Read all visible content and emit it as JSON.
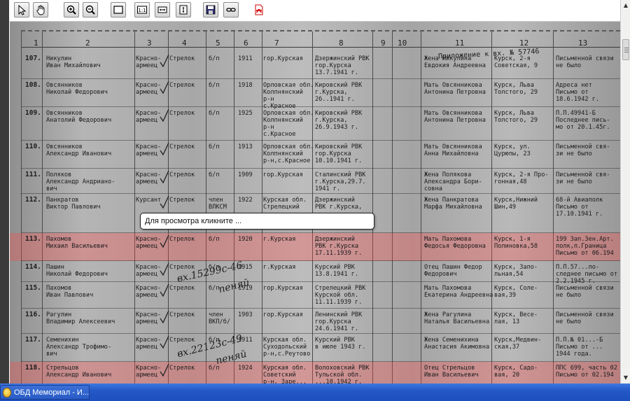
{
  "toolbar": {
    "buttons": [
      {
        "name": "pointer-tool-button",
        "icon": "arrow-pointer-icon"
      },
      {
        "name": "pan-tool-button",
        "icon": "hand-icon"
      },
      {
        "name": "zoom-in-button",
        "icon": "zoom-in-icon"
      },
      {
        "name": "zoom-out-button",
        "icon": "zoom-out-icon"
      },
      {
        "name": "fit-page-button",
        "icon": "page-frame-icon"
      },
      {
        "name": "actual-size-button",
        "icon": "one-to-one-icon",
        "label": "1:1"
      },
      {
        "name": "fit-width-button",
        "icon": "fit-width-icon"
      },
      {
        "name": "fit-height-button",
        "icon": "fit-height-icon"
      },
      {
        "name": "save-button",
        "icon": "floppy-disk-icon"
      },
      {
        "name": "link-button",
        "icon": "chain-link-icon"
      },
      {
        "name": "pdf-button",
        "icon": "pdf-icon"
      }
    ]
  },
  "document": {
    "column_numbers": [
      "1",
      "2",
      "3",
      "4",
      "5",
      "6",
      "7",
      "8",
      "9",
      "10",
      "11",
      "12",
      "13"
    ],
    "header_note": "Приложение к вх. № 57746",
    "rows": [
      {
        "num": "107.",
        "name": "Никулин\nИван Михайлович",
        "rank": "Красно-\nармеец",
        "pos": "Стрелок",
        "party": "б/п",
        "year": "1911",
        "birth": "гор.Курская",
        "rvk": "Дзержинский РВК\nгор.Курска\n13.7.1941 г.",
        "relative": "Жена Никулина\nЕвдокия Андреевна",
        "address": "Курск, 2-я\nСоветская, 9",
        "note": "Письменной связи\nне было"
      },
      {
        "num": "108.",
        "name": "Овсянников\nНиколай Федорович",
        "rank": "Красно-\nармеец",
        "pos": "Стрелок",
        "party": "б/п",
        "year": "1918",
        "birth": "Орловская обл.\nКолпнянский\nр-н\nс.Красное",
        "rvk": "Кировский РВК\nг.Курска,\n26..1941 г.",
        "relative": "Мать Овсянникова\nАнтонина Петровна",
        "address": "Курск, Льва\nТолстого, 29",
        "note": "Адреса нет\nПисьмо от\n18.6.1942 г."
      },
      {
        "num": "109.",
        "name": "Овсянников\nАнатолий Федорович",
        "rank": "Красно-\nармеец",
        "pos": "Стрелок",
        "party": "б/п",
        "year": "1925",
        "birth": "Орловская обл.\nКолпнянский\nр-н\nс.Красное",
        "rvk": "Кировский РВК\nг.Курска,\n26.9.1943 г.",
        "relative": "Мать Овсянникова\nАнтонина Петровна",
        "address": "Курск, Льва\nТолстого, 29",
        "note": "П.П.49941-Б\nПоследнее пись-\nмо от 20.1.45г."
      },
      {
        "num": "110.",
        "name": "Овсянников\nАлександр Иванович",
        "rank": "Красно-\nармеец",
        "pos": "Стрелок",
        "party": "б/п",
        "year": "1913",
        "birth": "Орловская обл.\nКолпнянский\nр-н,с.Красное",
        "rvk": "Кировский РВК\nгор.Курска\n10.10.1941 г.",
        "relative": "Мать Овсянникова\nАнна Михайловна",
        "address": "Курск, ул.\nЦурюпы, 23",
        "note": "Письменной свя-\nзи не было"
      },
      {
        "num": "111.",
        "name": "Поляков\nАлександр Андриано-\nвич",
        "rank": "Красно-\nармеец",
        "pos": "Стрелок",
        "party": "б/п",
        "year": "1909",
        "birth": "гор.Курская",
        "rvk": "Сталинский РВК\nг.Курска,29.7.\n1941 г.",
        "relative": "Жена Полякова\nАлександра Бори-\nсовна",
        "address": "Курск, 2-я Про-\nгонная,48",
        "note": "Письменной свя-\nзи не было"
      },
      {
        "num": "112.",
        "name": "Панкратов\nВиктор Павлович",
        "rank": "Курсант",
        "pos": "Стрелок",
        "party": "член\nВЛКСМ",
        "year": "1922",
        "birth": "Курская обл.\nСтрелецкий",
        "rvk": "Дзержинский\nРВК г.Курска,",
        "relative": "Жена Панкратова\nМарфа Михайловна",
        "address": "Курск,Нижний\nШин,49",
        "note": "68-й Авиаполк\nПисьмо от\n17.10.1941 г."
      },
      {
        "num": "113.",
        "name": "Пахомов\nМихаил Васильевич",
        "rank": "Красно-\nармеец",
        "pos": "Стрелок",
        "party": "б/п",
        "year": "1920",
        "birth": "г.Курская",
        "rvk": "Дзержинский\nРВК г.Курска\n17.11.1939 г.",
        "relative": "Мать Пахомова\nФедосья Федоровна",
        "address": "Курск, 1-я\nПолиновка,58",
        "note": "199 Зап.Зен.Арт.\nполк,п.Граница\nПисьмо от 06.194"
      },
      {
        "num": "114.",
        "name": "Пашин\nНиколай Федорович",
        "rank": "Красно-\nармеец",
        "pos": "Стрелок",
        "party": "б/п",
        "year": "1915",
        "birth": "г.Курская",
        "rvk": "Курский РВК\n13.8.1941 г.",
        "relative": "Отец Пашин Федор\nФедорович",
        "address": "Курск, Запо-\nльная,54",
        "note": "П.П.57...по-\nследнее письмо от\n2.2.1945 г."
      },
      {
        "num": "115.",
        "name": "Пахомов\nИван Павлович",
        "rank": "Красно-\nармеец",
        "pos": "Стрелок",
        "party": "б/п",
        "year": "1919",
        "birth": "гор.Курская",
        "rvk": "Стрелецкий РВК\nКурской обл.\n11.11.1939 г.",
        "relative": "Мать Пахомова\nЕкатерина Андреевна",
        "address": "Курск, Соле-\nвая,39",
        "note": "Письменной связи\nне было"
      },
      {
        "num": "116.",
        "name": "Рагулин\nВладимир Алексеевич",
        "rank": "Красно-\nармеец",
        "pos": "Стрелок",
        "party": "член\nВКП/б/",
        "year": "1903",
        "birth": "гор.Курская",
        "rvk": "Ленинский РВК\nгор.Курска\n24.6.1941 г.",
        "relative": "Жена Рагулина\nНаталья Васильевна",
        "address": "Курск, Весе-\nлая, 13",
        "note": "Письменной связи\nне было"
      },
      {
        "num": "117.",
        "name": "Семенихин\nАлександр Трофимо-\nвич",
        "rank": "Красно-\nармеец",
        "pos": "Стрелок",
        "party": "б/п",
        "year": "1911",
        "birth": "Курская обл.\nСуходольский\nр-н,с.Реутово",
        "rvk": "Курский РВК\nв июле 1943 г.",
        "relative": "Жена Семенихина\nАнастасия Акимовна",
        "address": "Курск,Медвин-\nская,37",
        "note": "П.П.№ 01...-Б\nПисьмо от ...\n1944 года."
      },
      {
        "num": "118.",
        "name": "Стрельцов\nАлександр Иванович",
        "rank": "Красно-\nармеец",
        "pos": "Стрелок",
        "party": "б/п",
        "year": "1924",
        "birth": "Курская обл.\nСоветский\nр-н, Заре...",
        "rvk": "Волоховский РВК\nТульской обл.\n...10.1942 г.",
        "relative": "Отец Стрельцов\nИван Васильевич",
        "address": "Курск, Садо-\nвая, 20",
        "note": "ППС 699, часть 02\nПисьмо от 02.194"
      }
    ],
    "handwritten": [
      "вх.15299с-46",
      "пеняй",
      "вх.22123с-49",
      "пеняй"
    ],
    "highlighted_rows": [
      6,
      11
    ],
    "highlight_color": "#ff4646"
  },
  "tooltip": {
    "text": "Для просмотра кликните ..."
  },
  "taskbar": {
    "window_title": "ОБД Мемориал - И..."
  }
}
